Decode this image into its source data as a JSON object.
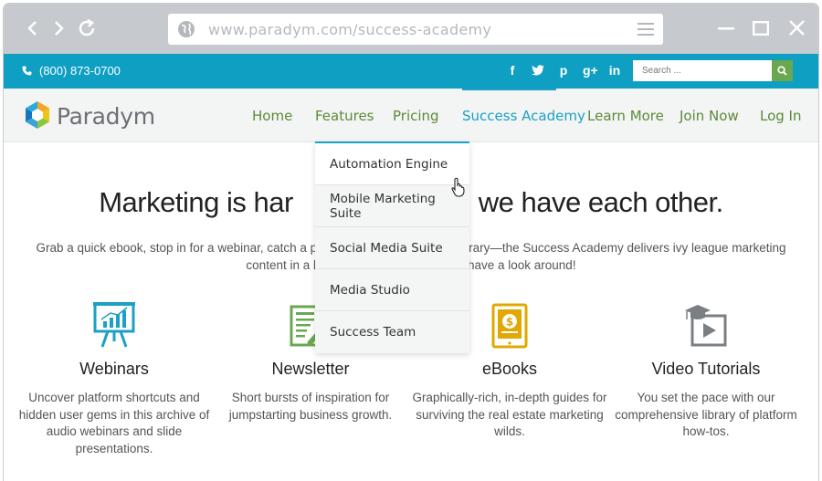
{
  "browser": {
    "url": "www.paradym.com/success-academy"
  },
  "topbar": {
    "phone": "(800) 873-0700",
    "socials": [
      "f",
      "t",
      "p",
      "g+",
      "in"
    ],
    "search_placeholder": "Search ..."
  },
  "brand": {
    "name": "Paradym"
  },
  "nav": {
    "items": [
      "Home",
      "Features",
      "Pricing",
      "Success Academy",
      "Learn More",
      "Join Now",
      "Log In"
    ],
    "active": "Success Academy"
  },
  "dropdown": {
    "items": [
      "Automation Engine",
      "Mobile Marketing Suite",
      "Social Media Suite",
      "Media Studio",
      "Success Team"
    ]
  },
  "hero": {
    "title_left": "Marketing is har",
    "title_right": "we have each other.",
    "desc_line1_left": "Grab a quick ebook, stop in for a webinar, catch a p",
    "desc_line1_right": "rary—the Success Academy delivers ivy league marketing",
    "desc_line2_left": "content in a l",
    "desc_line2_right": "have a look around!"
  },
  "features": [
    {
      "title": "Webinars",
      "desc": "Uncover platform shortcuts and hidden user gems in this archive of audio webinars and slide presentations.",
      "icon": "presentation-board-icon"
    },
    {
      "title": "Newsletter",
      "desc": "Short bursts of inspiration for jumpstarting business growth.",
      "icon": "newsletter-icon"
    },
    {
      "title": "eBooks",
      "desc": "Graphically-rich, in-depth guides for surviving the real estate marketing wilds.",
      "icon": "ebook-icon"
    },
    {
      "title": "Video Tutorials",
      "desc": "You set the pace with our comprehensive library of platform how-tos.",
      "icon": "video-tutorial-icon"
    }
  ],
  "colors": {
    "brand_blue": "#0f9fc3",
    "nav_green": "#5d8a38",
    "search_green": "#6aa84f",
    "chrome_gray": "#c6c9cd"
  }
}
